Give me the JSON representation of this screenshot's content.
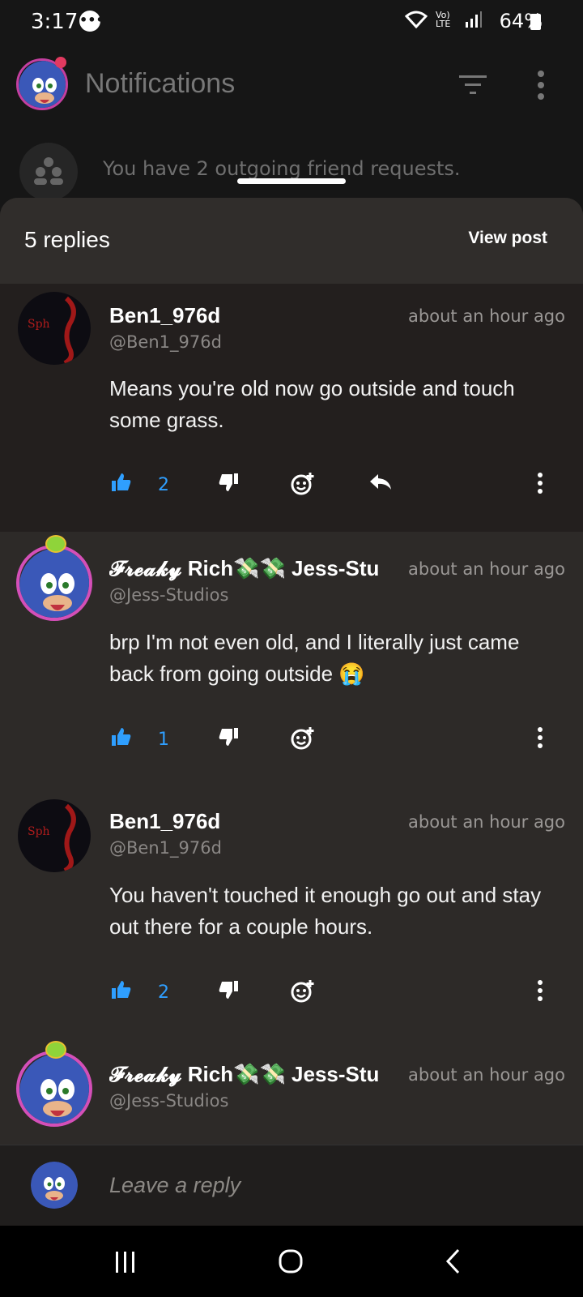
{
  "status": {
    "time": "3:17",
    "network": "Vo) LTE",
    "battery": "64%"
  },
  "header": {
    "title": "Notifications"
  },
  "friend_requests": {
    "text": "You have 2 outgoing friend requests."
  },
  "sheet": {
    "replies_label": "5 replies",
    "view_post_label": "View post"
  },
  "replies": [
    {
      "name": "Ben1_976d",
      "handle": "@Ben1_976d",
      "time": "about an hour ago",
      "body": "Means you're old now go outside and touch some grass.",
      "likes": "2"
    },
    {
      "name": "𝓕𝓻𝓮𝓪𝓴𝔂 Rich💸💸 Jess-Stu",
      "handle": "@Jess-Studios",
      "time": "about an hour ago",
      "body": "brp I'm not even old, and I literally just came back from going outside 😭",
      "likes": "1"
    },
    {
      "name": "Ben1_976d",
      "handle": "@Ben1_976d",
      "time": "about an hour ago",
      "body": "You haven't touched it enough go out and stay out there for a couple hours.",
      "likes": "2"
    },
    {
      "name": "𝓕𝓻𝓮𝓪𝓴𝔂 Rich💸💸 Jess-Stu",
      "handle": "@Jess-Studios",
      "time": "about an hour ago"
    }
  ],
  "reply_input": {
    "placeholder": "Leave a reply"
  },
  "colors": {
    "accent": "#2f9fff",
    "sheet_bg": "#2d2a28",
    "page_bg": "#161616"
  }
}
